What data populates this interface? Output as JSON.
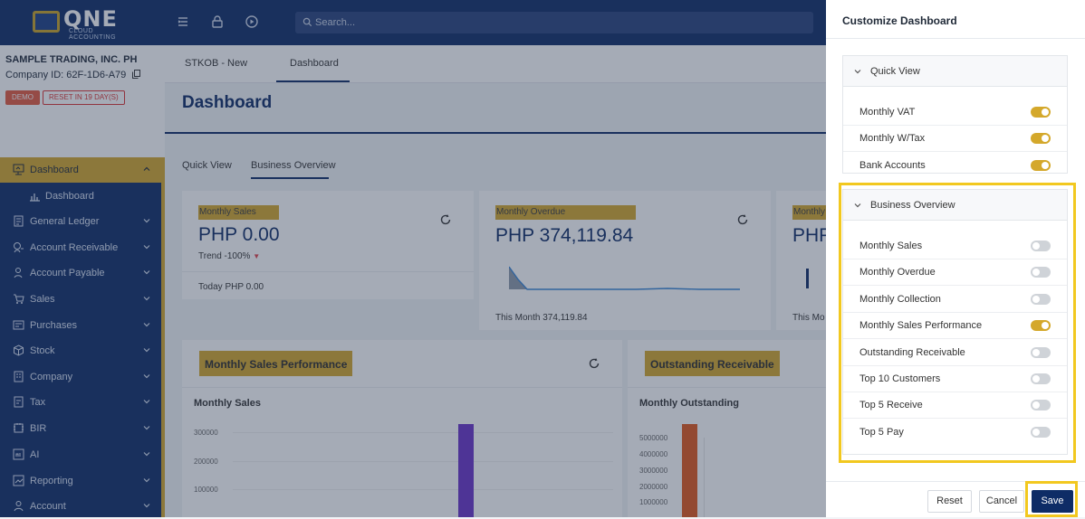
{
  "topbar": {
    "logo_text": "QNE",
    "logo_sub": "CLOUD ACCOUNTING",
    "search_placeholder": "Search..."
  },
  "sidebar": {
    "company_name": "SAMPLE TRADING, INC. PH",
    "company_id": "Company ID: 62F-1D6-A79",
    "badge_demo": "DEMO",
    "badge_reset": "RESET IN 19 DAY(S)",
    "items": [
      {
        "label": "Dashboard",
        "icon": "dashboard-icon"
      },
      {
        "label": "Dashboard",
        "icon": "bar-chart-icon"
      },
      {
        "label": "General Ledger",
        "icon": "ledger-icon"
      },
      {
        "label": "Account Receivable",
        "icon": "receivable-icon"
      },
      {
        "label": "Account Payable",
        "icon": "payable-icon"
      },
      {
        "label": "Sales",
        "icon": "cart-icon"
      },
      {
        "label": "Purchases",
        "icon": "purchases-icon"
      },
      {
        "label": "Stock",
        "icon": "box-icon"
      },
      {
        "label": "Company",
        "icon": "building-icon"
      },
      {
        "label": "Tax",
        "icon": "tax-icon"
      },
      {
        "label": "BIR",
        "icon": "bir-icon"
      },
      {
        "label": "AI",
        "icon": "ai-icon"
      },
      {
        "label": "Reporting",
        "icon": "reporting-icon"
      },
      {
        "label": "Account",
        "icon": "user-icon"
      }
    ]
  },
  "main": {
    "tabs": [
      "STKOB - New",
      "Dashboard"
    ],
    "page_title": "Dashboard",
    "sub_tabs": [
      "Quick View",
      "Business Overview"
    ],
    "cards": [
      {
        "title": "Monthly Sales",
        "value": "PHP 0.00",
        "trend": "Trend -100%",
        "footer": "Today PHP 0.00"
      },
      {
        "title": "Monthly Overdue",
        "value": "PHP 374,119.84",
        "footer": "This Month 374,119.84"
      },
      {
        "title": "Monthly",
        "value": "PHP",
        "footer": "This Mo"
      }
    ],
    "msp": {
      "heading": "Monthly Sales Performance",
      "subheading": "Monthly Sales",
      "y_ticks": [
        "300000",
        "200000",
        "100000"
      ]
    },
    "outstanding": {
      "heading": "Outstanding Receivable",
      "subheading": "Monthly Outstanding",
      "y_ticks": [
        "5000000",
        "4000000",
        "3000000",
        "2000000",
        "1000000"
      ]
    }
  },
  "panel": {
    "title": "Customize Dashboard",
    "sections": [
      {
        "label": "Quick View",
        "rows": [
          {
            "label": "Monthly VAT",
            "on": true
          },
          {
            "label": "Monthly W/Tax",
            "on": true
          },
          {
            "label": "Bank Accounts",
            "on": true
          }
        ]
      },
      {
        "label": "Business Overview",
        "rows": [
          {
            "label": "Monthly Sales",
            "on": false
          },
          {
            "label": "Monthly Overdue",
            "on": false
          },
          {
            "label": "Monthly Collection",
            "on": false
          },
          {
            "label": "Monthly Sales Performance",
            "on": true
          },
          {
            "label": "Outstanding Receivable",
            "on": false
          },
          {
            "label": "Top 10 Customers",
            "on": false
          },
          {
            "label": "Top 5 Receive",
            "on": false
          },
          {
            "label": "Top 5 Pay",
            "on": false
          }
        ]
      }
    ],
    "reset_label": "Reset",
    "cancel_label": "Cancel",
    "save_label": "Save"
  },
  "colors": {
    "navy": "#0e2c66",
    "gold": "#d4a82b",
    "highlight": "#f2c81f"
  }
}
